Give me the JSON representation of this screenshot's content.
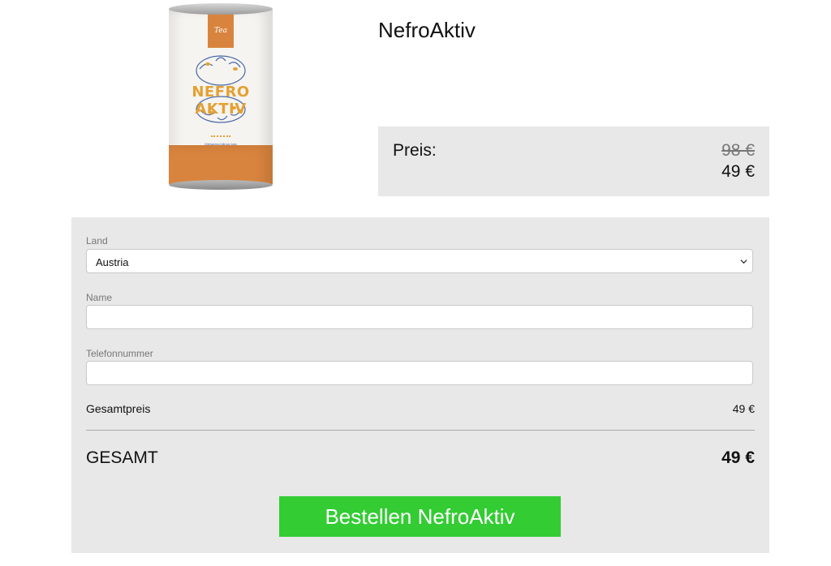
{
  "product": {
    "title": "NefroAktiv",
    "image": {
      "label": "Tea",
      "brand": "NEFRO AKTIV",
      "subtitle": "Mješavina biljnog čaja",
      "colors": {
        "band": "#d9843e",
        "brand": "#e3a133",
        "leaves": "#4a69a7"
      }
    }
  },
  "price": {
    "label": "Preis:",
    "old": "98 €",
    "current": "49 €"
  },
  "form": {
    "country": {
      "label": "Land",
      "value": "Austria"
    },
    "name": {
      "label": "Name",
      "value": "",
      "placeholder": ""
    },
    "phone": {
      "label": "Telefonnummer",
      "value": "",
      "placeholder": ""
    },
    "subtotal": {
      "label": "Gesamtpreis",
      "value": "49 €"
    },
    "total": {
      "label": "GESAMT",
      "value": "49 €"
    },
    "submit_label": "Bestellen NefroAktiv"
  },
  "colors": {
    "panel_bg": "#e8e8e8",
    "button_bg": "#33cc33",
    "button_text": "#ffffff"
  }
}
